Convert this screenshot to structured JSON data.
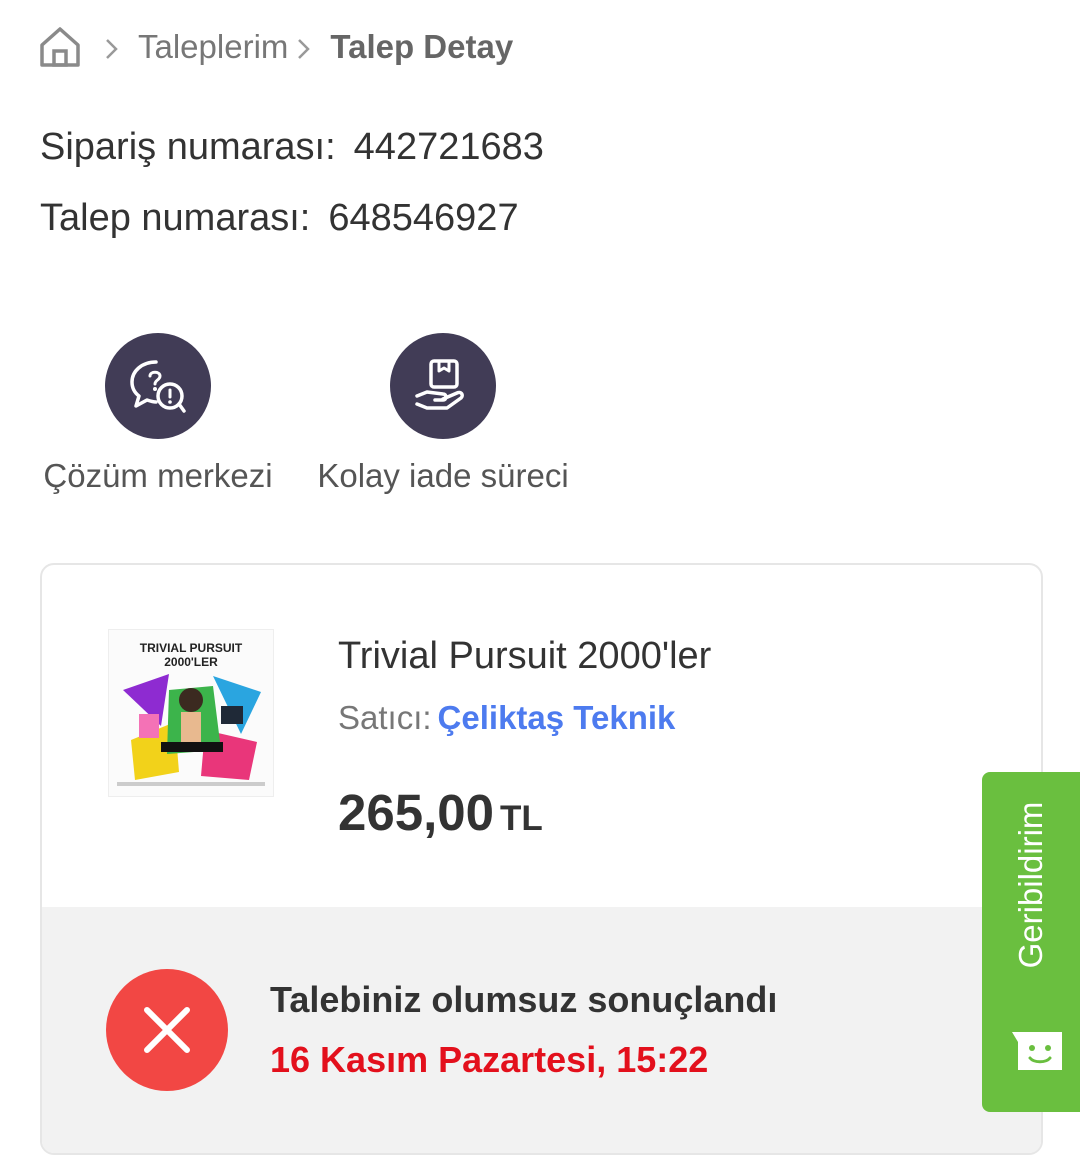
{
  "breadcrumb": {
    "home_icon": "home-icon",
    "separator_icon": "chevron-right-icon",
    "items": [
      "Taleplerim",
      "Talep Detay"
    ]
  },
  "order": {
    "order_label": "Sipariş numarası:",
    "order_number": "442721683",
    "request_label": "Talep numarası:",
    "request_number": "648546927"
  },
  "actions": [
    {
      "label": "Çözüm merkezi",
      "icon": "chat-question-icon"
    },
    {
      "label": "Kolay iade süreci",
      "icon": "hand-package-icon"
    }
  ],
  "product": {
    "image_title": "TRIVIAL PURSUIT",
    "image_subtitle": "2000'LER",
    "name": "Trivial Pursuit 2000'ler",
    "seller_label": "Satıcı:",
    "seller_name": "Çeliktaş Teknik",
    "price": "265,00",
    "currency": "TL"
  },
  "status": {
    "icon": "close-circle-icon",
    "title": "Talebiniz olumsuz sonuçlandı",
    "date": "16 Kasım Pazartesi, 15:22"
  },
  "feedback": {
    "label": "Geribildirim",
    "icon": "smile-chat-icon"
  },
  "colors": {
    "action_circle": "#413c56",
    "seller_link": "#4d7bef",
    "status_red": "#e3101c",
    "x_circle": "#f24744",
    "feedback_green": "#6abf3f"
  }
}
